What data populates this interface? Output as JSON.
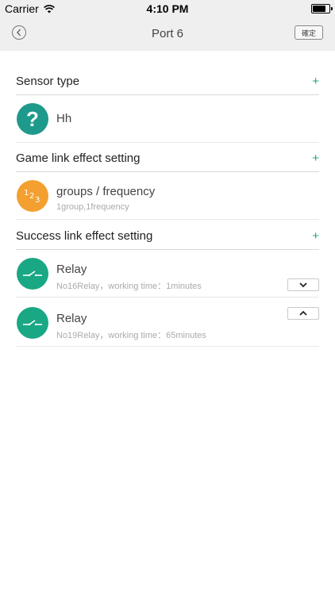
{
  "status_bar": {
    "carrier": "Carrier",
    "time": "4:10 PM",
    "battery_level": 0.9
  },
  "nav": {
    "title": "Port 6",
    "confirm_label": "確定"
  },
  "colors": {
    "teal": "#1aa784",
    "orange": "#f3a030",
    "dark_teal": "#1e9a8c"
  },
  "sections": {
    "sensor_type": {
      "title": "Sensor type",
      "add_icon": "+",
      "items": [
        {
          "icon": "question-icon",
          "glyph": "?",
          "title": "Hh"
        }
      ]
    },
    "game_link": {
      "title": "Game link effect setting",
      "add_icon": "+",
      "items": [
        {
          "icon": "numbers-icon",
          "title": "groups / frequency",
          "subtitle": "1group,1frequency"
        }
      ]
    },
    "success_link": {
      "title": "Success link effect setting",
      "add_icon": "+",
      "items": [
        {
          "icon": "relay-switch-icon",
          "title": "Relay",
          "subtitle": "No16Relay，working time：1minutes",
          "arrow": "chevron-down-icon"
        },
        {
          "icon": "relay-switch-icon",
          "title": "Relay",
          "subtitle": "No19Relay，working time：65minutes",
          "arrow": "chevron-up-icon"
        }
      ]
    }
  }
}
